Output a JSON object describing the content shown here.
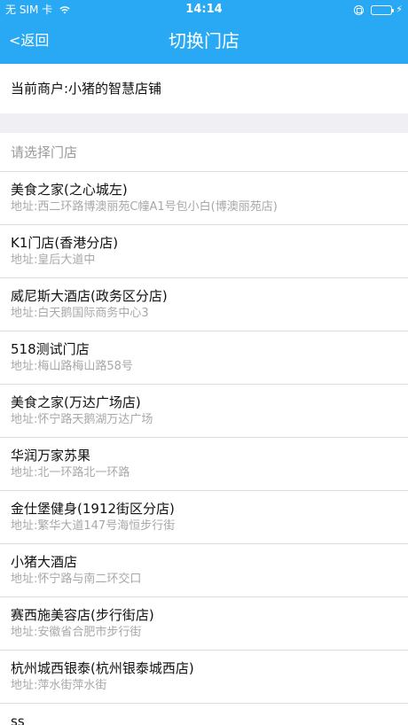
{
  "status_bar": {
    "carrier": "无 SIM 卡",
    "time": "14:14"
  },
  "nav": {
    "back_label": "<返回",
    "title": "切换门店"
  },
  "merchant_label": "当前商户:小猪的智慧店铺",
  "select_hint": "请选择门店",
  "stores": [
    {
      "name": "美食之家(之心城左)",
      "address": "地址:西二环路博澳丽苑C幢A1号包小白(博澳丽苑店)"
    },
    {
      "name": "K1门店(香港分店)",
      "address": "地址:皇后大道中"
    },
    {
      "name": "威尼斯大酒店(政务区分店)",
      "address": "地址:白天鹅国际商务中心3"
    },
    {
      "name": "518测试门店",
      "address": "地址:梅山路梅山路58号"
    },
    {
      "name": "美食之家(万达广场店)",
      "address": "地址:怀宁路天鹅湖万达广场"
    },
    {
      "name": "华润万家苏果",
      "address": "地址:北一环路北一环路"
    },
    {
      "name": "金仕堡健身(1912街区分店)",
      "address": "地址:繁华大道147号海恒步行街"
    },
    {
      "name": "小猪大酒店",
      "address": "地址:怀宁路与南二环交口"
    },
    {
      "name": "赛西施美容店(步行街店)",
      "address": "地址:安徽省合肥市步行街"
    },
    {
      "name": "杭州城西银泰(杭州银泰城西店)",
      "address": "地址:萍水街萍水街"
    },
    {
      "name": "ss",
      "address": ""
    }
  ],
  "colors": {
    "accent": "#29a9f3",
    "section_gap": "#efeff4",
    "divider": "#dcdcdc",
    "secondary_text": "#a8a8a8"
  },
  "icons": [
    "wifi-icon",
    "orientation-lock-icon",
    "battery-icon",
    "charging-bolt-icon"
  ]
}
